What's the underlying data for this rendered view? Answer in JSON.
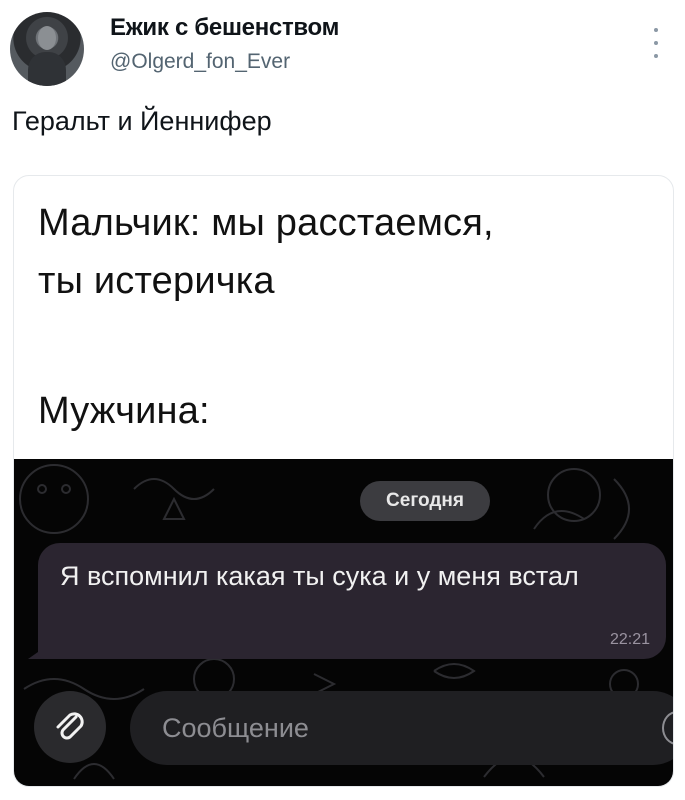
{
  "tweet": {
    "author_name": "Ежик с бешенством",
    "author_handle": "@Olgerd_fon_Ever",
    "text": "Геральт и Йеннифер"
  },
  "meme": {
    "line1": "Мальчик: мы расстаемся,",
    "line2": "ты истеричка",
    "line3": "Мужчина:"
  },
  "chat": {
    "date_label": "Сегодня",
    "message_text": "Я вспомнил какая ты сука и у меня встал",
    "message_time": "22:21",
    "input_placeholder": "Сообщение"
  },
  "icons": {
    "more": "more-vertical-icon",
    "attach": "paperclip-icon",
    "emoji": "emoji-icon"
  },
  "colors": {
    "chat_background": "#050505",
    "bubble": "#2b2530",
    "handle": "#536471"
  }
}
